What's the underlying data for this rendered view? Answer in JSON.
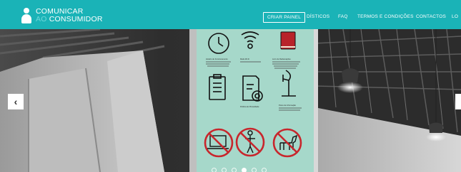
{
  "header": {
    "logo_line1": "COMUNICAR",
    "logo_line2_prefix": "AO",
    "logo_line2": "CONSUMIDOR",
    "nav": [
      {
        "label": "CRIAR PAINEL"
      },
      {
        "label": "DÍSTICOS"
      },
      {
        "label": "FAQ"
      },
      {
        "label": "TERMOS E CONDIÇÕES"
      },
      {
        "label": "CONTACTOS"
      },
      {
        "label": "LO"
      }
    ],
    "brand_color": "#1ab3b7"
  },
  "slider": {
    "prev_icon": "chevron-left-icon",
    "prev_glyph": "‹",
    "next_icon": "chevron-right-icon",
    "dots_count": 6,
    "active_dot": 4,
    "sign_captions": {
      "clock": "Horário de Funcionamento",
      "wifi": "Rede Wi-Fi",
      "book": "Livro de Reclamações",
      "rules": "Regulamento",
      "policy": "Política de Privacidade",
      "stand": "Posto de Informação"
    }
  }
}
